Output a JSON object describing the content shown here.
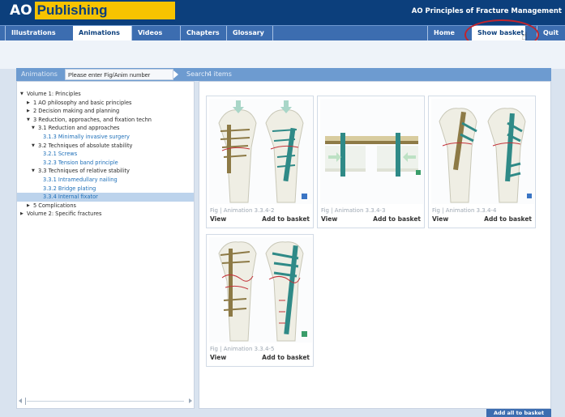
{
  "header": {
    "logo_ao": "AO",
    "logo_publishing": "Publishing",
    "app_title": "AO Principles of Fracture Management"
  },
  "nav": {
    "tabs": [
      "Illustrations",
      "Animations",
      "Videos",
      "Chapters",
      "Glossary"
    ],
    "active_tab": "Animations",
    "right_tabs": [
      "Home",
      "Show basket",
      "Quit"
    ]
  },
  "toolbar": {
    "label": "Animations",
    "search_placeholder": "Please enter Fig/Anim number",
    "search_label": "Search",
    "count": "4 items"
  },
  "tree": [
    {
      "label": "Volume 1: Principles",
      "level": 0,
      "toggle": "open"
    },
    {
      "label": "1 AO philosophy and basic principles",
      "level": 1,
      "toggle": "closed"
    },
    {
      "label": "2 Decision making and planning",
      "level": 1,
      "toggle": "closed"
    },
    {
      "label": "3 Reduction, approaches, and fixation techn",
      "level": 1,
      "toggle": "open"
    },
    {
      "label": "3.1 Reduction and approaches",
      "level": 2,
      "toggle": "open"
    },
    {
      "label": "3.1.3 Minimally invasive surgery",
      "level": 3,
      "link": true
    },
    {
      "label": "3.2 Techniques of absolute stability",
      "level": 2,
      "toggle": "open"
    },
    {
      "label": "3.2.1 Screws",
      "level": 3,
      "link": true
    },
    {
      "label": "3.2.3 Tension band principle",
      "level": 3,
      "link": true
    },
    {
      "label": "3.3 Techniques of relative stability",
      "level": 2,
      "toggle": "open"
    },
    {
      "label": "3.3.1 Intramedullary nailing",
      "level": 3,
      "link": true
    },
    {
      "label": "3.3.2 Bridge plating",
      "level": 3,
      "link": true
    },
    {
      "label": "3.3.4 Internal fixator",
      "level": 3,
      "link": true,
      "selected": true
    },
    {
      "label": "5 Complications",
      "level": 1,
      "toggle": "closed"
    },
    {
      "label": "Volume 2: Specific fractures",
      "level": 0,
      "toggle": "closed"
    }
  ],
  "items": [
    {
      "caption": "Fig | Animation 3.3.4-2",
      "view": "View",
      "add": "Add to basket",
      "thumb": "two-tibias-arrows"
    },
    {
      "caption": "Fig | Animation 3.3.4-3",
      "view": "View",
      "add": "Add to basket",
      "thumb": "plate-screws-section"
    },
    {
      "caption": "Fig | Animation 3.3.4-4",
      "view": "View",
      "add": "Add to basket",
      "thumb": "two-tibias-plates"
    },
    {
      "caption": "Fig | Animation 3.3.4-5",
      "view": "View",
      "add": "Add to basket",
      "thumb": "two-tibias-fracture"
    }
  ],
  "footer": {
    "add_all": "Add all to basket"
  },
  "colors": {
    "header_bg": "#0c3f7c",
    "nav_bg": "#3c6db0",
    "logo_yellow": "#f7c300",
    "toolbar_bg": "#6d9bd0",
    "link": "#1e6fb8",
    "selection": "#bcd3ec",
    "highlight_ring": "#c2242c"
  }
}
